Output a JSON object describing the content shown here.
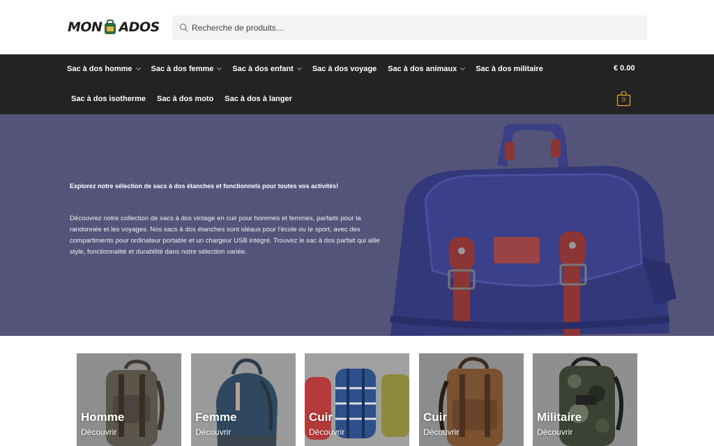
{
  "header": {
    "logo": {
      "text_left": "MON",
      "text_right": "ADOS"
    },
    "search": {
      "placeholder": "Recherche de produits…"
    }
  },
  "nav": {
    "row1": [
      {
        "label": "Sac à dos homme",
        "has_dropdown": true
      },
      {
        "label": "Sac à dos femme",
        "has_dropdown": true
      },
      {
        "label": "Sac à dos enfant",
        "has_dropdown": true
      },
      {
        "label": "Sac à dos voyage",
        "has_dropdown": false
      },
      {
        "label": "Sac à dos animaux",
        "has_dropdown": true
      },
      {
        "label": "Sac à dos militaire",
        "has_dropdown": false
      }
    ],
    "row2": [
      {
        "label": "Sac à dos isotherme"
      },
      {
        "label": "Sac à dos moto"
      },
      {
        "label": "Sac à dos à langer"
      }
    ],
    "cart_total": "€ 0.00",
    "cart_count": "0"
  },
  "hero": {
    "title": "Explorez notre sélection de sacs à dos étanches et fonctionnels pour toutes vos activités!",
    "text": "Découvrez notre collection de sacs à dos vintage en cuir pour hommes et femmes, parfaits pour la randonnée et les voyages. Nos sacs à dos étanches sont idéaux pour l'école ou le sport, avec des compartiments pour ordinateur portable et un chargeur USB intégré. Trouvez le sac à dos parfait qui allie style, fonctionnalité et durabilité dans notre sélection variée."
  },
  "categories": [
    {
      "title": "Homme",
      "subtitle": "Découvrir"
    },
    {
      "title": "Femme",
      "subtitle": "Découvrir"
    },
    {
      "title": "Cuir",
      "subtitle": "Découvrir"
    },
    {
      "title": "Cuir",
      "subtitle": "Découvrir"
    },
    {
      "title": "Militaire",
      "subtitle": "Découvrir"
    }
  ],
  "colors": {
    "nav_bg": "#232323",
    "hero_bg": "#54547a",
    "cart_accent": "#e6a72c"
  }
}
